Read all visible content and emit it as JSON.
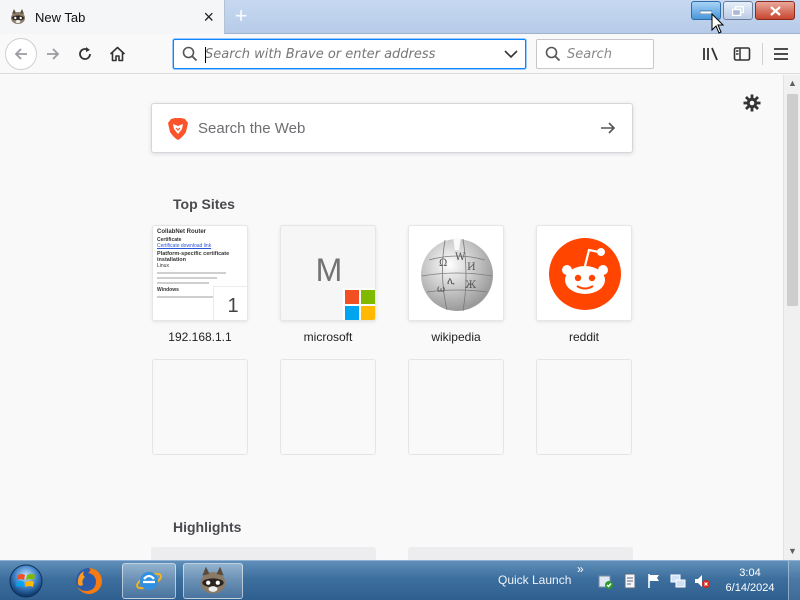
{
  "tab": {
    "title": "New Tab",
    "close": "×",
    "new_tab": "+"
  },
  "window_controls": {
    "minimize": "minimize-icon",
    "restore": "restore-icon",
    "close": "close-icon"
  },
  "navbar": {
    "url_placeholder": "Search with Brave or enter address",
    "search_placeholder": "Search"
  },
  "page": {
    "web_search_placeholder": "Search the Web",
    "top_sites_title": "Top Sites",
    "highlights_title": "Highlights",
    "top_sites": [
      {
        "label": "192.168.1.1",
        "badge": "1"
      },
      {
        "label": "microsoft",
        "letter": "M"
      },
      {
        "label": "wikipedia"
      },
      {
        "label": "reddit"
      }
    ],
    "thumbnail": {
      "heading": "CollabNet Router",
      "sub": "Certificate",
      "link": "Certificate download link",
      "section": "Platform-specific certificate installation",
      "label1": "Linux",
      "label2": "Windows"
    }
  },
  "taskbar": {
    "quick_launch": "Quick Launch",
    "chevron": "»",
    "time": "3:04",
    "date": "6/14/2024"
  },
  "colors": {
    "accent": "#0a84ff",
    "reddit": "#ff4500",
    "brave": "#fb542b"
  }
}
